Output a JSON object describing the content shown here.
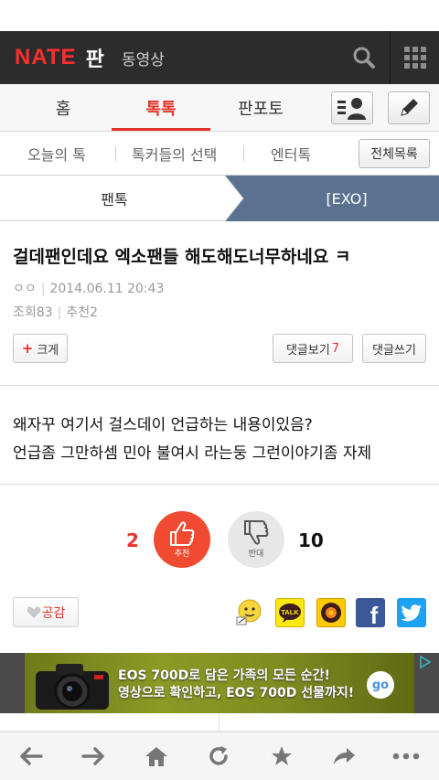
{
  "header": {
    "logo_nate": "NATE",
    "logo_pan": "판",
    "video_link": "동영상"
  },
  "main_tabs": [
    {
      "label": "홈"
    },
    {
      "label": "톡톡"
    },
    {
      "label": "판포토"
    }
  ],
  "sub_tabs": [
    {
      "label": "오늘의 톡"
    },
    {
      "label": "톡커들의 선택"
    },
    {
      "label": "엔터톡"
    }
  ],
  "all_list_button": "전체목록",
  "breadcrumb": {
    "left": "팬톡",
    "right": "[EXO]"
  },
  "article": {
    "title": "걸데팬인데요 엑소팬들 해도해도너무하네요 ㅋ",
    "author": "ㅇㅇ",
    "date": "2014.06.11 20:43",
    "views_label": "조회",
    "views": "83",
    "recommend_label": "추천",
    "recommend": "2",
    "enlarge_label": "크게",
    "view_comments_label": "댓글보기",
    "comment_count": "7",
    "write_comment_label": "댓글쓰기",
    "body_lines": [
      "왜자꾸 여기서 걸스데이 언급하는 내용이있음?",
      "언급좀 그만하셈 민아 불여시 라는둥 그런이야기좀 자제"
    ]
  },
  "vote": {
    "up_count": "2",
    "up_label": "추천",
    "down_count": "10",
    "down_label": "반대"
  },
  "like_label": "공감",
  "share_icons": [
    "emoticon-icon",
    "kakaotalk-icon",
    "kakaostory-icon",
    "facebook-icon",
    "twitter-icon"
  ],
  "share_labels": {
    "kakaotalk": "TALK",
    "facebook": "f"
  },
  "ad": {
    "line1": "EOS 700D로 담은 가족의 모든 순간!",
    "line2": "영상으로 확인하고, EOS 700D 선물까지!",
    "go": "go"
  },
  "colors": {
    "accent": "#e8322a",
    "header_bg": "#2c2c2c",
    "breadcrumb_active": "#5a7290",
    "facebook": "#3b5998",
    "twitter": "#1da1f2",
    "kakao": "#ffe812"
  }
}
